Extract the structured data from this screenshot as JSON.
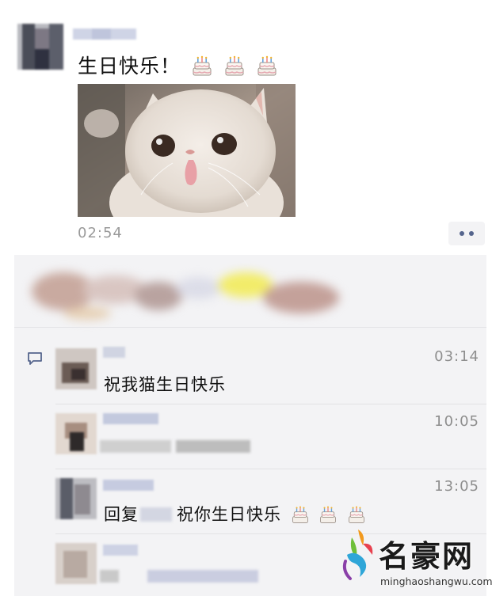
{
  "post": {
    "text": "生日快乐！",
    "emoji": [
      "birthday-cake-icon",
      "birthday-cake-icon",
      "birthday-cake-icon"
    ],
    "time": "02:54"
  },
  "comments": [
    {
      "time": "03:14",
      "text": "祝我猫生日快乐"
    },
    {
      "time": "10:05",
      "text": ""
    },
    {
      "time": "13:05",
      "reply_prefix": "回复",
      "text": "祝你生日快乐"
    },
    {
      "time": "",
      "text": ""
    }
  ],
  "watermark": {
    "title": "名豪网",
    "url": "minghaoshangwu.com"
  },
  "colors": {
    "panel_bg": "#f3f3f5",
    "link_blue": "#55658d",
    "time_gray": "#9a9a9a"
  }
}
